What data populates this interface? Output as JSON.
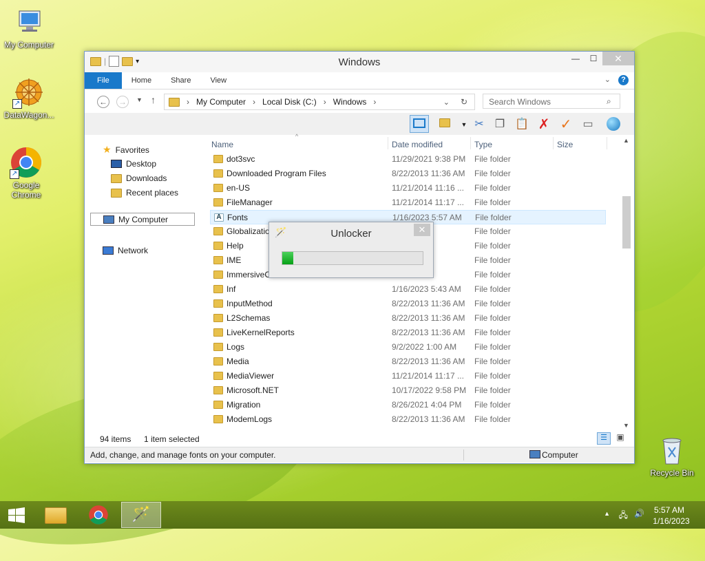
{
  "desktop": {
    "icons": [
      {
        "label": "My Computer"
      },
      {
        "label": "DataWagon..."
      },
      {
        "label": "Google Chrome"
      },
      {
        "label": "Recycle Bin"
      }
    ]
  },
  "explorer": {
    "title": "Windows",
    "ribbon_tabs": [
      "File",
      "Home",
      "Share",
      "View"
    ],
    "help": "?",
    "breadcrumb": [
      "My Computer",
      "Local Disk (C:)",
      "Windows"
    ],
    "search_placeholder": "Search Windows",
    "columns": {
      "name": "Name",
      "date": "Date modified",
      "type": "Type",
      "size": "Size"
    },
    "nav": {
      "favorites": "Favorites",
      "desktop": "Desktop",
      "downloads": "Downloads",
      "recent": "Recent places",
      "computer": "My Computer",
      "network": "Network"
    },
    "rows": [
      {
        "name": "dot3svc",
        "date": "11/29/2021 9:38 PM",
        "type": "File folder"
      },
      {
        "name": "Downloaded Program Files",
        "date": "8/22/2013 11:36 AM",
        "type": "File folder"
      },
      {
        "name": "en-US",
        "date": "11/21/2014 11:16 ...",
        "type": "File folder"
      },
      {
        "name": "FileManager",
        "date": "11/21/2014 11:17 ...",
        "type": "File folder"
      },
      {
        "name": "Fonts",
        "date": "1/16/2023 5:57 AM",
        "type": "File folder"
      },
      {
        "name": "Globalizatio",
        "date": ":36 AM",
        "type": "File folder"
      },
      {
        "name": "Help",
        "date": ":00 AM",
        "type": "File folder"
      },
      {
        "name": "IME",
        "date": "1:17 ...",
        "type": "File folder"
      },
      {
        "name": "ImmersiveC",
        "date": ":59 AM",
        "type": "File folder"
      },
      {
        "name": "Inf",
        "date": "1/16/2023 5:43 AM",
        "type": "File folder"
      },
      {
        "name": "InputMethod",
        "date": "8/22/2013 11:36 AM",
        "type": "File folder"
      },
      {
        "name": "L2Schemas",
        "date": "8/22/2013 11:36 AM",
        "type": "File folder"
      },
      {
        "name": "LiveKernelReports",
        "date": "8/22/2013 11:36 AM",
        "type": "File folder"
      },
      {
        "name": "Logs",
        "date": "9/2/2022 1:00 AM",
        "type": "File folder"
      },
      {
        "name": "Media",
        "date": "8/22/2013 11:36 AM",
        "type": "File folder"
      },
      {
        "name": "MediaViewer",
        "date": "11/21/2014 11:17 ...",
        "type": "File folder"
      },
      {
        "name": "Microsoft.NET",
        "date": "10/17/2022 9:58 PM",
        "type": "File folder"
      },
      {
        "name": "Migration",
        "date": "8/26/2021 4:04 PM",
        "type": "File folder"
      },
      {
        "name": "ModemLogs",
        "date": "8/22/2013 11:36 AM",
        "type": "File folder"
      }
    ],
    "status": {
      "items": "94 items",
      "selected": "1 item selected"
    },
    "info": {
      "description": "Add, change, and manage fonts on your computer.",
      "location": "Computer"
    }
  },
  "unlocker": {
    "title": "Unlocker",
    "close": "✕",
    "progress_percent": 8
  },
  "taskbar": {
    "time": "5:57 AM",
    "date": "1/16/2023"
  }
}
